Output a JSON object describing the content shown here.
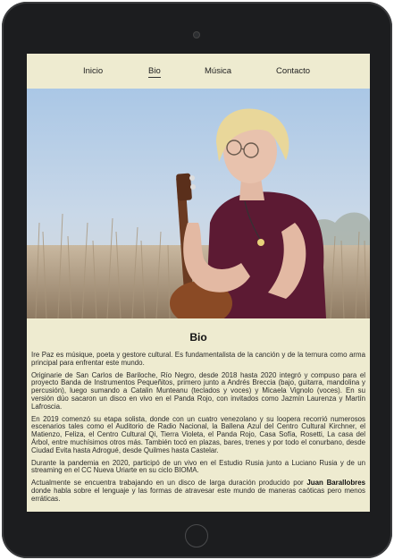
{
  "nav": {
    "items": [
      {
        "label": "Inicio"
      },
      {
        "label": "Bio"
      },
      {
        "label": "Música"
      },
      {
        "label": "Contacto"
      }
    ],
    "active": "Bio"
  },
  "hero": {
    "alt": "Musician playing a small guitar outdoors"
  },
  "bio": {
    "title": "Bio",
    "paragraphs": [
      "Ire Paz es músique, poeta y gestore cultural. Es fundamentalista de la canción y de la ternura como arma principal para enfrentar este mundo.",
      "Originarie de San Carlos de Bariloche, Río Negro, desde 2018 hasta 2020 integró y compuso para el proyecto Banda de Instrumentos Pequeñitos, primero junto a Andrés Breccia (bajo, guitarra, mandolina y percusión), luego sumando a Catalin Munteanu (teclados y voces) y Micaela Vignolo (voces). En su versión dúo sacaron un disco en vivo en el Panda Rojo, con invitados como Jazmín Laurenza y Martín Lafroscia.",
      "En 2019 comenzó su etapa solista, donde con un cuatro venezolano y su loopera recorrió numerosos escenarios tales como el Auditorio de Radio Nacional, la Ballena Azul del Centro Cultural Kirchner, el Matienzo, Feliza, el Centro Cultural Qi, Tierra Violeta, el Panda Rojo, Casa Sofía, Rosetti, La casa del Árbol, entre muchísimos otros más. También tocó en plazas, bares, trenes y por todo el conurbano, desde Ciudad Evita hasta Adrogué, desde Quilmes hasta Castelar.",
      "Durante la pandemia en 2020, participó de un vivo en el Estudio Rusia junto a Luciano Rusia y de un streaming en el CC Nueva Uriarte en su ciclo BIOMA."
    ],
    "last_paragraph": {
      "before": "Actualmente se encuentra trabajando en un disco de larga duración producido por ",
      "bold": "Juan Barallobres",
      "after": " donde habla sobre el lenguaje y las formas de atravesar este mundo de maneras caóticas pero menos erráticas."
    }
  },
  "colors": {
    "screen_bg": "#eeebd0",
    "frame": "#1c1d1f",
    "text": "#2a2a2a"
  }
}
